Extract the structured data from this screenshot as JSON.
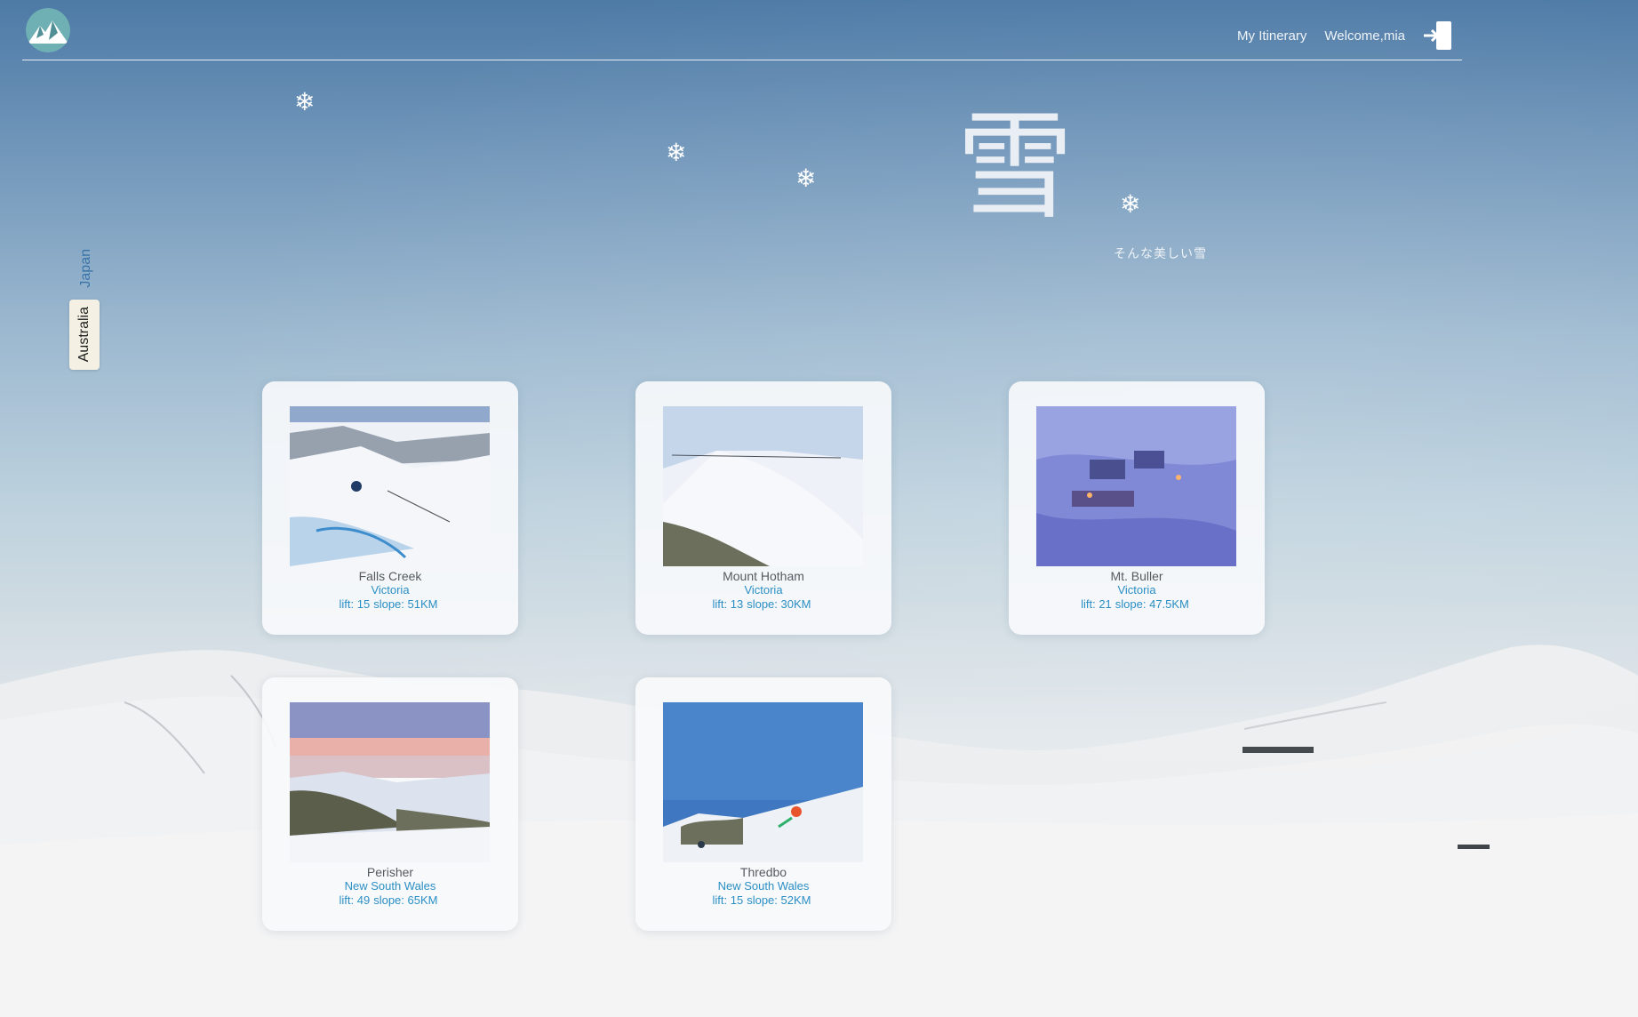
{
  "header": {
    "logo_icon": "mountain-logo-icon",
    "nav_itinerary": "My Itinerary",
    "welcome_prefix": "Welcome,",
    "username": "mia",
    "logout_icon": "sign-in-icon"
  },
  "hero": {
    "kanji": "雪",
    "subtitle": "そんな美しい雪",
    "flake_glyph": "❄"
  },
  "country_tabs": [
    {
      "label": "Japan",
      "active": false
    },
    {
      "label": "Australia",
      "active": true
    }
  ],
  "resorts": [
    {
      "name": "Falls Creek",
      "region": "Victoria",
      "lift_text": "lift: 15",
      "slope_text": "slope: 51KM"
    },
    {
      "name": "Mount Hotham",
      "region": "Victoria",
      "lift_text": "lift: 13",
      "slope_text": "slope: 30KM"
    },
    {
      "name": "Mt. Buller",
      "region": "Victoria",
      "lift_text": "lift: 21",
      "slope_text": "slope: 47.5KM"
    },
    {
      "name": "Perisher",
      "region": "New South Wales",
      "lift_text": "lift: 49",
      "slope_text": "slope: 65KM"
    },
    {
      "name": "Thredbo",
      "region": "New South Wales",
      "lift_text": "lift: 15",
      "slope_text": "slope: 52KM"
    }
  ],
  "colors": {
    "accent_link": "#2b8fc4",
    "tab_active_bg": "#f4f1e4",
    "sky_top": "#4d7aa6"
  }
}
